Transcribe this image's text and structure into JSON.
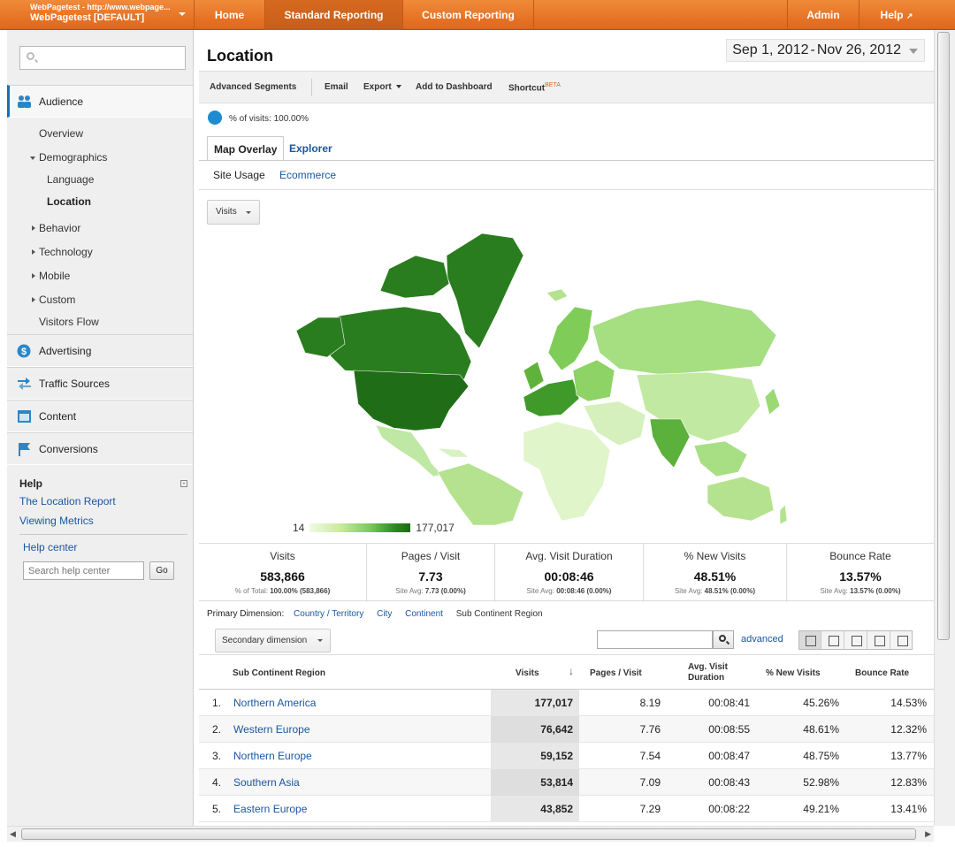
{
  "account": {
    "line1": "WebPagetest - http://www.webpage...",
    "line2": "WebPagetest [DEFAULT]"
  },
  "nav": {
    "home": "Home",
    "standard": "Standard Reporting",
    "custom": "Custom Reporting",
    "admin": "Admin",
    "help": "Help"
  },
  "sidebar": {
    "audience": "Audience",
    "overview": "Overview",
    "demographics": "Demographics",
    "language": "Language",
    "location": "Location",
    "behavior": "Behavior",
    "technology": "Technology",
    "mobile": "Mobile",
    "custom": "Custom",
    "visitors_flow": "Visitors Flow",
    "advertising": "Advertising",
    "traffic_sources": "Traffic Sources",
    "content": "Content",
    "conversions": "Conversions"
  },
  "help": {
    "title": "Help",
    "link1": "The Location Report",
    "link2": "Viewing Metrics",
    "center": "Help center",
    "search_placeholder": "Search help center",
    "go": "Go"
  },
  "page": {
    "title": "Location",
    "date_start": "Sep 1, 2012",
    "date_sep": "-",
    "date_end": "Nov 26, 2012",
    "pct_visits": "% of visits: 100.00%"
  },
  "toolbar": {
    "segments": "Advanced Segments",
    "email": "Email",
    "export": "Export",
    "dashboard": "Add to Dashboard",
    "shortcut": "Shortcut",
    "beta": "BETA"
  },
  "tabs": {
    "map": "Map Overlay",
    "explorer": "Explorer",
    "site_usage": "Site Usage",
    "ecommerce": "Ecommerce"
  },
  "map": {
    "metric": "Visits",
    "legend_min": "14",
    "legend_max": "177,017"
  },
  "scorecards": [
    {
      "title": "Visits",
      "value": "583,866",
      "sub_label": "% of Total:",
      "sub_value": "100.00% (583,866)"
    },
    {
      "title": "Pages / Visit",
      "value": "7.73",
      "sub_label": "Site Avg:",
      "sub_value": "7.73 (0.00%)"
    },
    {
      "title": "Avg. Visit Duration",
      "value": "00:08:46",
      "sub_label": "Site Avg:",
      "sub_value": "00:08:46 (0.00%)"
    },
    {
      "title": "% New Visits",
      "value": "48.51%",
      "sub_label": "Site Avg:",
      "sub_value": "48.51% (0.00%)"
    },
    {
      "title": "Bounce Rate",
      "value": "13.57%",
      "sub_label": "Site Avg:",
      "sub_value": "13.57% (0.00%)"
    }
  ],
  "dimensions": {
    "label": "Primary Dimension:",
    "country": "Country / Territory",
    "city": "City",
    "continent": "Continent",
    "subcontinent": "Sub Continent Region",
    "secondary": "Secondary dimension",
    "advanced": "advanced"
  },
  "table": {
    "headers": {
      "region": "Sub Continent Region",
      "visits": "Visits",
      "pages": "Pages / Visit",
      "duration": "Avg. Visit Duration",
      "new": "% New Visits",
      "bounce": "Bounce Rate"
    },
    "rows": [
      {
        "rank": "1.",
        "region": "Northern America",
        "visits": "177,017",
        "pages": "8.19",
        "duration": "00:08:41",
        "new": "45.26%",
        "bounce": "14.53%"
      },
      {
        "rank": "2.",
        "region": "Western Europe",
        "visits": "76,642",
        "pages": "7.76",
        "duration": "00:08:55",
        "new": "48.61%",
        "bounce": "12.32%"
      },
      {
        "rank": "3.",
        "region": "Northern Europe",
        "visits": "59,152",
        "pages": "7.54",
        "duration": "00:08:47",
        "new": "48.75%",
        "bounce": "13.77%"
      },
      {
        "rank": "4.",
        "region": "Southern Asia",
        "visits": "53,814",
        "pages": "7.09",
        "duration": "00:08:43",
        "new": "52.98%",
        "bounce": "12.83%"
      },
      {
        "rank": "5.",
        "region": "Eastern Europe",
        "visits": "43,852",
        "pages": "7.29",
        "duration": "00:08:22",
        "new": "49.21%",
        "bounce": "13.41%"
      }
    ]
  },
  "colors": {
    "brand_orange": "#e8771f",
    "link_blue": "#1a57a0",
    "map_dark": "#1f6d16",
    "map_light": "#e3f5c8"
  }
}
